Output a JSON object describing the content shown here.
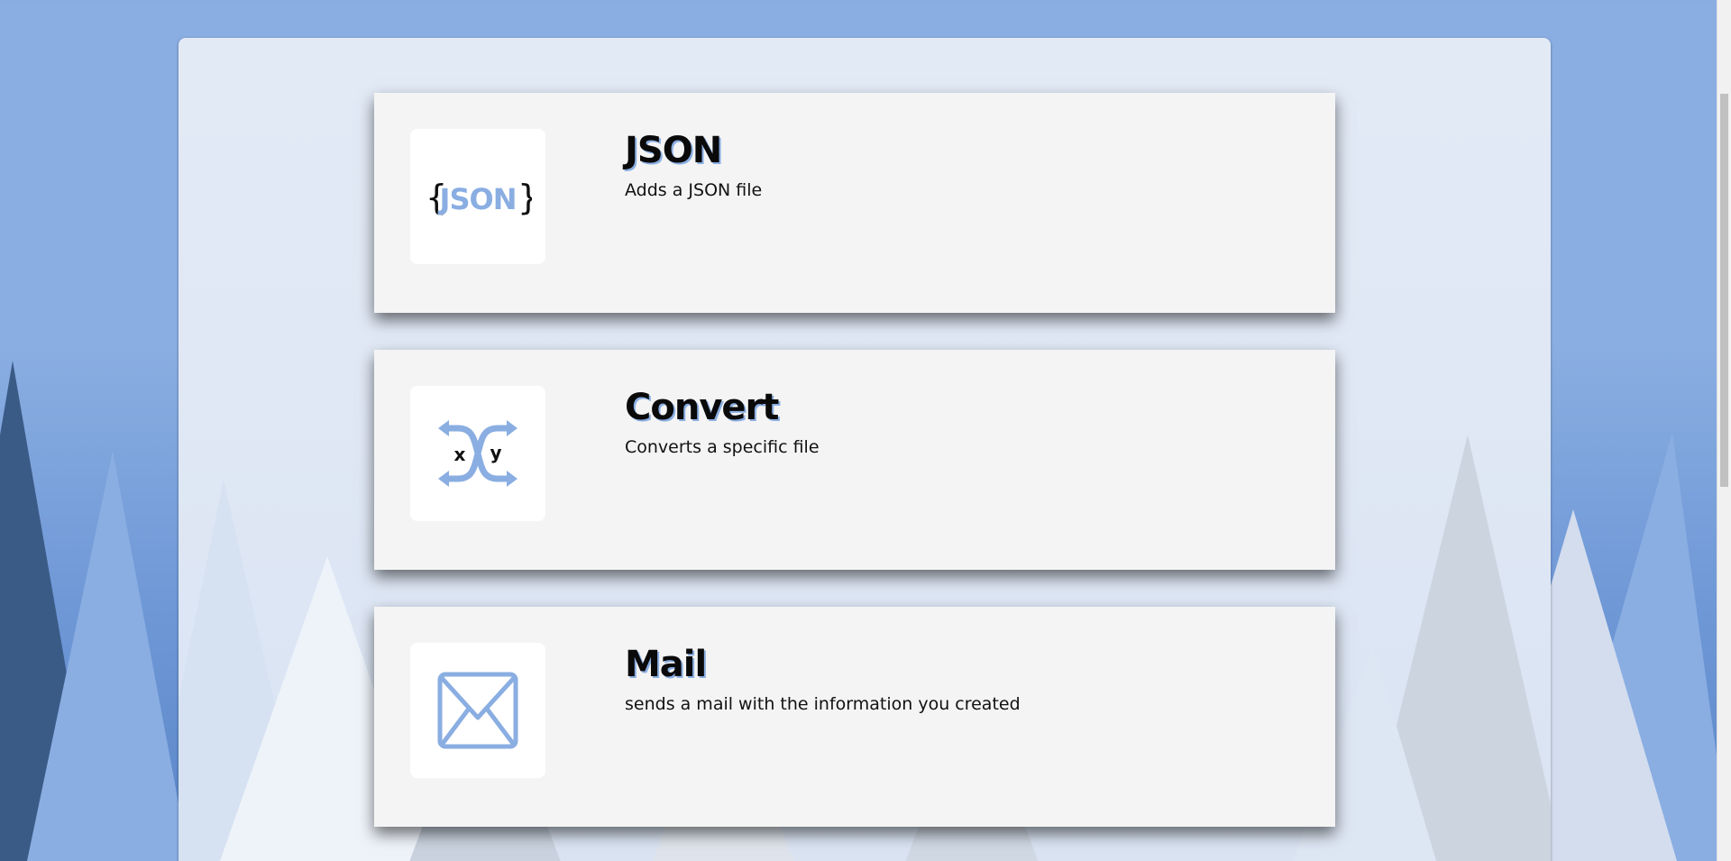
{
  "colors": {
    "accent": "#8aaee2",
    "card_bg": "#f4f4f4",
    "panel_bg": "#e0e8f5"
  },
  "cards": [
    {
      "title": "JSON",
      "description": "Adds a JSON file",
      "icon": "json-braces-icon",
      "icon_text": {
        "open": "{",
        "label": "JSON",
        "close": "}"
      }
    },
    {
      "title": "Convert",
      "description": "Converts a specific file",
      "icon": "convert-arrows-icon",
      "icon_text": {
        "left": "x",
        "right": "y"
      }
    },
    {
      "title": "Mail",
      "description": "sends a mail with the information you created",
      "icon": "envelope-icon"
    }
  ]
}
